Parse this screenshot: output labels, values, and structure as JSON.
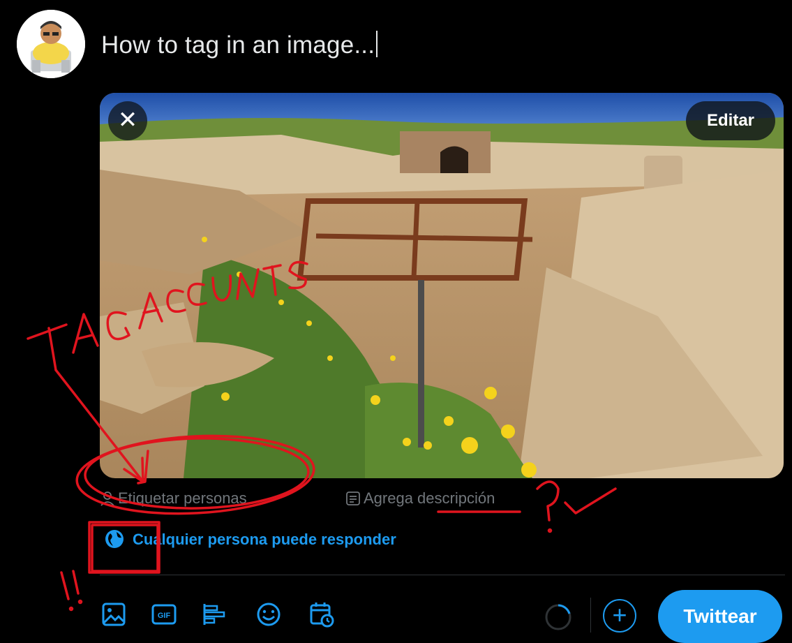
{
  "compose": {
    "text": "How to tag in an image..."
  },
  "media": {
    "edit_label": "Editar",
    "close_glyph": "✕"
  },
  "media_actions": {
    "tag_people": "Etiquetar personas",
    "add_description": "Agrega descripción"
  },
  "reply_setting": {
    "label": "Cualquier persona puede responder"
  },
  "toolbar": {
    "icons": [
      "image-icon",
      "gif-icon",
      "poll-icon",
      "emoji-icon",
      "schedule-icon"
    ],
    "gif_text": "GIF",
    "add_glyph": "+",
    "tweet_label": "Twittear"
  },
  "colors": {
    "accent": "#1d9bf0",
    "annotation": "#e0141e",
    "muted": "#71767b"
  },
  "annotations": {
    "tag_accounts": "TAG ACCOUNTS"
  }
}
